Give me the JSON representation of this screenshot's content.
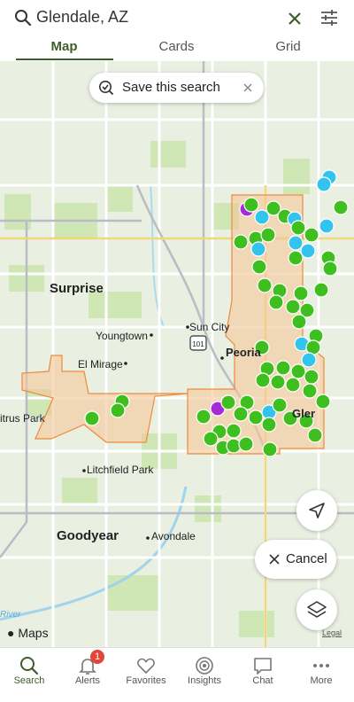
{
  "search": {
    "query": "Glendale, AZ"
  },
  "tabs": [
    {
      "label": "Map",
      "active": true
    },
    {
      "label": "Cards",
      "active": false
    },
    {
      "label": "Grid",
      "active": false
    }
  ],
  "save_search": {
    "label": "Save this search"
  },
  "map": {
    "places": [
      {
        "label": "Surprise",
        "major": true
      },
      {
        "label": "Sun City",
        "major": false
      },
      {
        "label": "Youngtown",
        "major": false
      },
      {
        "label": "Peoria",
        "major": false
      },
      {
        "label": "El Mirage",
        "major": false
      },
      {
        "label": "itrus Park",
        "major": false
      },
      {
        "label": "Litchfield Park",
        "major": false
      },
      {
        "label": "Goodyear",
        "major": true
      },
      {
        "label": "Avondale",
        "major": false
      },
      {
        "label": "Glendale",
        "major": false
      }
    ],
    "highway_shield": "101",
    "river_label": "River",
    "brand": "Maps",
    "legal": "Legal"
  },
  "controls": {
    "cancel_label": "Cancel"
  },
  "colors": {
    "accent": "#3f5d2b",
    "pin_green": "#3fbf1f",
    "pin_blue": "#33c4ee",
    "pin_purple": "#a42bd6",
    "area_fill": "#f5c79a",
    "area_stroke": "#ef8a3c"
  },
  "bottom_nav": [
    {
      "label": "Search",
      "icon": "search-icon",
      "active": true
    },
    {
      "label": "Alerts",
      "icon": "bell-icon",
      "badge": "1"
    },
    {
      "label": "Favorites",
      "icon": "heart-icon"
    },
    {
      "label": "Insights",
      "icon": "insights-icon"
    },
    {
      "label": "Chat",
      "icon": "chat-icon"
    },
    {
      "label": "More",
      "icon": "more-icon"
    }
  ]
}
